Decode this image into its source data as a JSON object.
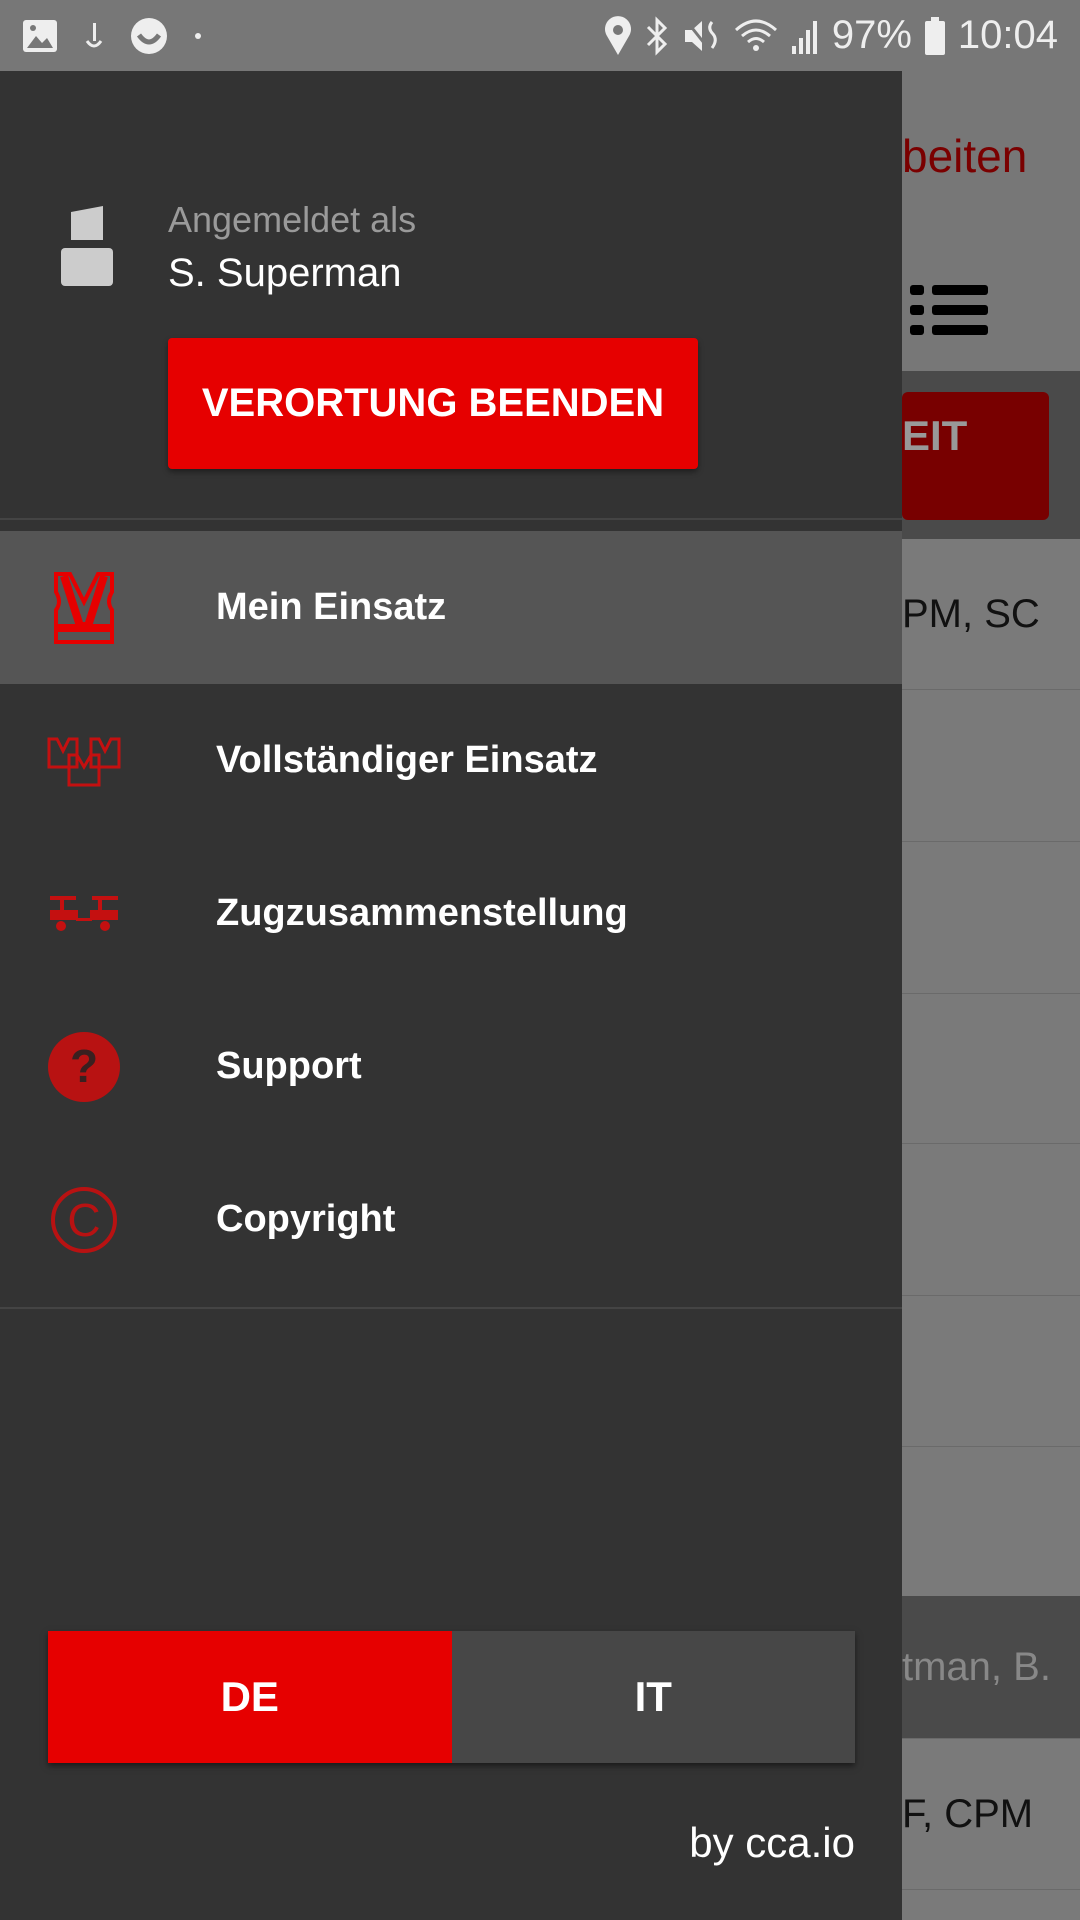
{
  "status_bar": {
    "battery": "97%",
    "time": "10:04",
    "icons": [
      "gallery-icon",
      "download-icon",
      "smiley-icon",
      "dot-icon",
      "location-icon",
      "bluetooth-icon",
      "mute-icon",
      "wifi-icon",
      "signal-icon",
      "battery-icon"
    ]
  },
  "background": {
    "title_fragment": "beiten",
    "button_fragment": "EIT",
    "rows": [
      "PM, SC",
      "",
      "",
      "",
      "",
      "",
      "",
      "tman, B.",
      "F, CPM"
    ]
  },
  "drawer": {
    "logged_in_label": "Angemeldet als",
    "user_name": "S. Superman",
    "end_button": "VERORTUNG BEENDEN",
    "menu": [
      {
        "label": "Mein Einsatz",
        "icon": "safety-vest-icon",
        "selected": true
      },
      {
        "label": "Vollständiger Einsatz",
        "icon": "team-vests-icon",
        "selected": false
      },
      {
        "label": "Zugzusammenstellung",
        "icon": "train-cars-icon",
        "selected": false
      },
      {
        "label": "Support",
        "icon": "help-icon",
        "selected": false
      },
      {
        "label": "Copyright",
        "icon": "copyright-icon",
        "selected": false
      }
    ],
    "languages": [
      {
        "label": "DE",
        "active": true
      },
      {
        "label": "IT",
        "active": false
      }
    ],
    "footer": "by cca.io"
  },
  "colors": {
    "accent": "#e60000",
    "icon_red": "#c41010",
    "drawer_bg": "#333333",
    "selected_bg": "#555555"
  }
}
